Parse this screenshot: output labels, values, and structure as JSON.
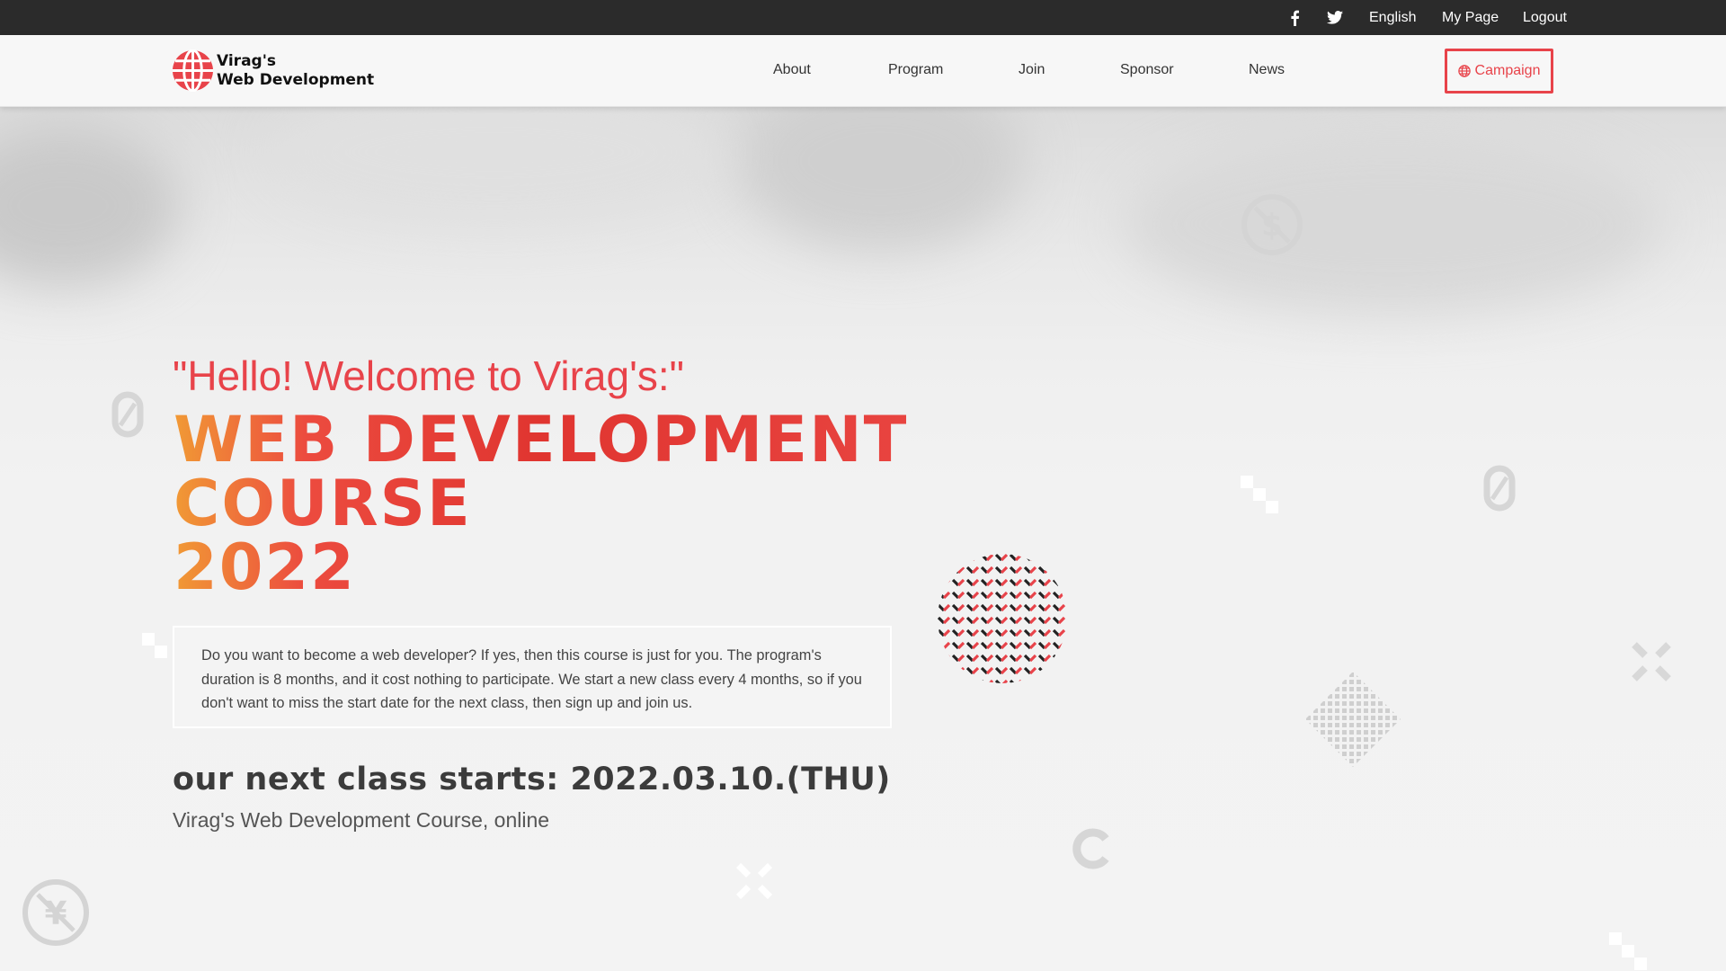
{
  "topbar": {
    "language": "English",
    "my_page": "My Page",
    "logout": "Logout"
  },
  "header": {
    "logo_line1": "Virag's",
    "logo_line2": "Web Development",
    "nav": [
      "About",
      "Program",
      "Join",
      "Sponsor",
      "News"
    ],
    "campaign_label": "Campaign"
  },
  "hero": {
    "welcome": "\"Hello! Welcome to Virag's:\"",
    "title_lines": [
      "WEB DEVELOPMENT",
      "COURSE",
      "2022"
    ],
    "description": "Do you want to become a web developer? If yes, then this course is just for you. The program's duration is 8 months, and it cost nothing to participate. We start a new class every 4 months, so if you don't want to miss the start date for the next class, then sign up and join us.",
    "next_class": "our next class starts: 2022.03.10.(THU)",
    "subline": "Virag's Web Development Course, online"
  },
  "colors": {
    "accent": "#e8434a",
    "topbar_bg": "#2b2b2b",
    "header_bg": "#f7f7f7"
  },
  "icons": [
    "facebook-icon",
    "twitter-icon",
    "globe-icon",
    "logo-globe-icon",
    "dollar-icon",
    "yen-icon"
  ]
}
